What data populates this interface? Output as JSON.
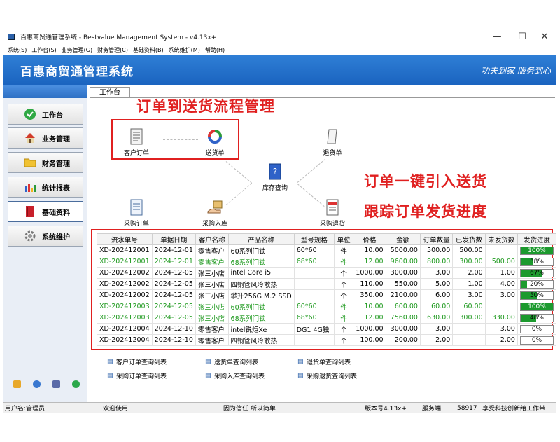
{
  "window": {
    "title": "百惠商贸通管理系统 - Bestvalue Management System - v4.13x+",
    "minimize": "—",
    "maximize": "☐",
    "close": "✕"
  },
  "menu": [
    "系统(S)",
    "工作台(S)",
    "业务管理(G)",
    "财务管理(C)",
    "基础资料(B)",
    "系统维护(M)",
    "帮助(H)"
  ],
  "banner": {
    "title": "百惠商贸通管理系统",
    "slogan": "功夫到家 服务到心"
  },
  "sidebar": {
    "items": [
      {
        "label": "工作台",
        "icon": "checkmark-icon"
      },
      {
        "label": "业务管理",
        "icon": "house-icon"
      },
      {
        "label": "财务管理",
        "icon": "folder-icon"
      },
      {
        "label": "统计报表",
        "icon": "bar-chart-icon"
      },
      {
        "label": "基础资料",
        "icon": "book-icon"
      },
      {
        "label": "系统维护",
        "icon": "gear-icon"
      }
    ]
  },
  "tab": {
    "label": "工作台"
  },
  "annotations": {
    "flow_title": "订单到送货流程管理",
    "line1": "订单一键引入送货",
    "line2": "跟踪订单发货进度"
  },
  "flow": {
    "customer_order": "客户订单",
    "delivery_order": "送货单",
    "return_order": "退货单",
    "inventory_query": "库存查询",
    "purchase_order": "采购订单",
    "purchase_in": "采购入库",
    "purchase_return": "采购退货"
  },
  "table": {
    "headers": [
      "流水单号",
      "单据日期",
      "客户名称",
      "产品名称",
      "型号规格",
      "单位",
      "价格",
      "金额",
      "订单数量",
      "已发货数",
      "未发货数",
      "发货进度"
    ],
    "rows": [
      {
        "id": "XD-202412001",
        "date": "2024-12-01",
        "customer": "零售客户",
        "product": "60系列门锁",
        "model": "60*60",
        "unit": "件",
        "price": "10.00",
        "amount": "5000.00",
        "qty": "500.00",
        "shipped": "500.00",
        "unshipped": "",
        "progress": "100%",
        "progress_value": 1.0,
        "green": false
      },
      {
        "id": "XD-202412001",
        "date": "2024-12-01",
        "customer": "零售客户",
        "product": "68系列门锁",
        "model": "68*60",
        "unit": "件",
        "price": "12.00",
        "amount": "9600.00",
        "qty": "800.00",
        "shipped": "300.00",
        "unshipped": "500.00",
        "progress": "38%",
        "progress_value": 0.38,
        "green": true
      },
      {
        "id": "XD-202412002",
        "date": "2024-12-05",
        "customer": "张三小店",
        "product": "intel Core i5",
        "model": "",
        "unit": "个",
        "price": "1000.00",
        "amount": "3000.00",
        "qty": "3.00",
        "shipped": "2.00",
        "unshipped": "1.00",
        "progress": "67%",
        "progress_value": 0.67,
        "green": false
      },
      {
        "id": "XD-202412002",
        "date": "2024-12-05",
        "customer": "张三小店",
        "product": "四铜管风冷散热",
        "model": "",
        "unit": "个",
        "price": "110.00",
        "amount": "550.00",
        "qty": "5.00",
        "shipped": "1.00",
        "unshipped": "4.00",
        "progress": "20%",
        "progress_value": 0.2,
        "green": false
      },
      {
        "id": "XD-202412002",
        "date": "2024-12-05",
        "customer": "张三小店",
        "product": "攀升256G M.2 SSD",
        "model": "",
        "unit": "个",
        "price": "350.00",
        "amount": "2100.00",
        "qty": "6.00",
        "shipped": "3.00",
        "unshipped": "3.00",
        "progress": "50%",
        "progress_value": 0.5,
        "green": false
      },
      {
        "id": "XD-202412003",
        "date": "2024-12-05",
        "customer": "张三小店",
        "product": "60系列门锁",
        "model": "60*60",
        "unit": "件",
        "price": "10.00",
        "amount": "600.00",
        "qty": "60.00",
        "shipped": "60.00",
        "unshipped": "",
        "progress": "100%",
        "progress_value": 1.0,
        "green": true
      },
      {
        "id": "XD-202412003",
        "date": "2024-12-05",
        "customer": "张三小店",
        "product": "68系列门锁",
        "model": "68*60",
        "unit": "件",
        "price": "12.00",
        "amount": "7560.00",
        "qty": "630.00",
        "shipped": "300.00",
        "unshipped": "330.00",
        "progress": "48%",
        "progress_value": 0.48,
        "green": true
      },
      {
        "id": "XD-202412004",
        "date": "2024-12-10",
        "customer": "零售客户",
        "product": "intel锐炬Xe",
        "model": "DG1 4G独",
        "unit": "个",
        "price": "1000.00",
        "amount": "3000.00",
        "qty": "3.00",
        "shipped": "",
        "unshipped": "3.00",
        "progress": "0%",
        "progress_value": 0,
        "green": false
      },
      {
        "id": "XD-202412004",
        "date": "2024-12-10",
        "customer": "零售客户",
        "product": "四铜管风冷散热",
        "model": "",
        "unit": "个",
        "price": "100.00",
        "amount": "200.00",
        "qty": "2.00",
        "shipped": "",
        "unshipped": "2.00",
        "progress": "0%",
        "progress_value": 0,
        "green": false
      }
    ]
  },
  "links": {
    "customer_order_list": "客户订单查询列表",
    "delivery_list": "送货单查询列表",
    "return_list": "退货单查询列表",
    "purchase_order_list": "采购订单查询列表",
    "purchase_in_list": "采购入库查询列表",
    "purchase_return_list": "采购退货查询列表"
  },
  "status": {
    "user": "用户名:管理员",
    "welcome": "欢迎使用",
    "motto": "因为信任 所以简单",
    "version": "版本号4.13x+",
    "mode": "服务端",
    "port": "58917",
    "company": "享受科技创新给工作带"
  }
}
